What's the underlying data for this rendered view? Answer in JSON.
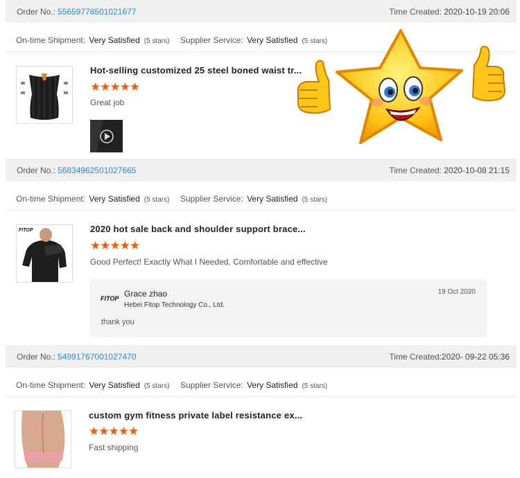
{
  "labels": {
    "order_no": "Order No.:",
    "time_created": "Time Created:",
    "ontime": "On-time Shipment:",
    "supplier": "Supplier Service:"
  },
  "orders": [
    {
      "number": "55659778501021677",
      "time": "2020-10-19 20:06",
      "ontime_value": "Very Satisfied",
      "ontime_stars": "(5 stars)",
      "supplier_value": "Very Satisfied",
      "supplier_stars": "(5 stars)",
      "product_title": "Hot-selling customized 25 steel boned waist tr...",
      "rating": "★★★★★",
      "comment": "Great job"
    },
    {
      "number": "56834962501027665",
      "time": "2020-10-08 21:15",
      "ontime_value": "Very Satisfied",
      "ontime_stars": "(5 stars)",
      "supplier_value": "Very Satisfied",
      "supplier_stars": "(5 stars)",
      "product_title": "2020 hot sale back and shoulder support brace...",
      "rating": "★★★★★",
      "comment": "Good Perfect! Exactly What I Needed, Comfortable and effective",
      "reply": {
        "logo": "FITOP",
        "name": "Grace zhao",
        "company": "Hebei Fitop Technology Co., Ltd.",
        "date": "19 Oct 2020",
        "text": "thank you"
      }
    },
    {
      "number": "54991767001027470",
      "time": "2020- 09-22 05:36",
      "ontime_value": "Very Satisfied",
      "ontime_stars": "(5 stars)",
      "supplier_value": "Very Satisfied",
      "supplier_stars": "(5 stars)",
      "product_title": "custom gym fitness private label resistance ex...",
      "rating": "★★★★★",
      "comment": "Fast shipping"
    }
  ],
  "colors": {
    "link": "#2f88d8",
    "star": "#f25c05",
    "header_bg": "#f0f0f0"
  },
  "icons": [
    "play-icon",
    "star-mascot-icon",
    "thumbs-up-icon"
  ]
}
